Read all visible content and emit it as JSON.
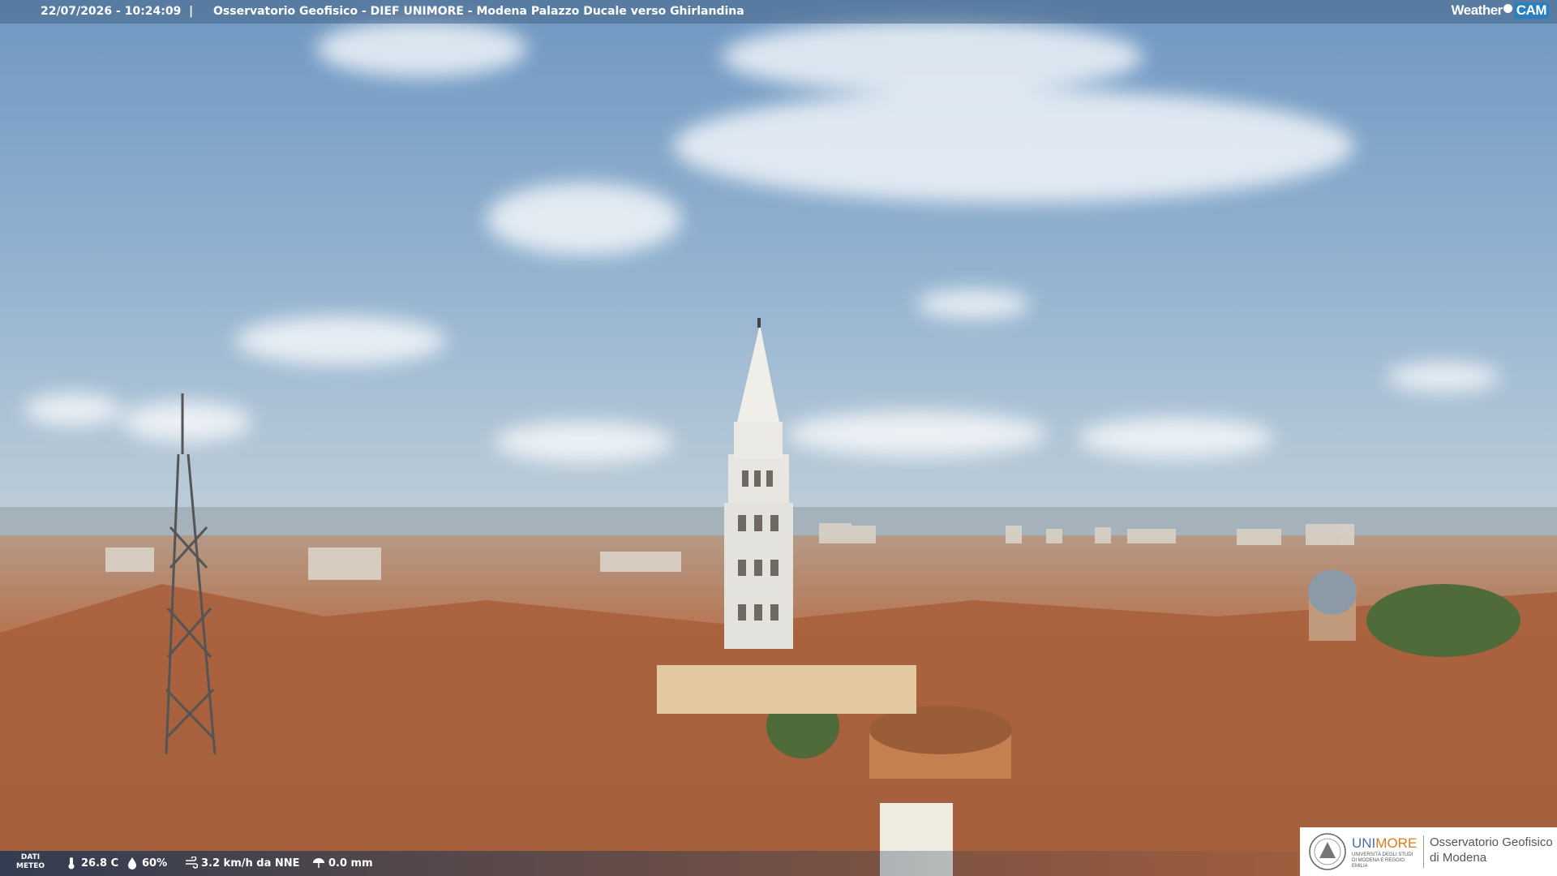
{
  "header": {
    "timestamp": "22/07/2026 - 10:24:09",
    "separator": "|",
    "title": "Osservatorio Geofisico - DIEF UNIMORE - Modena Palazzo Ducale verso Ghirlandina",
    "brand_left": "Weather",
    "brand_right": "CAM"
  },
  "weather": {
    "label_line1": "DATI",
    "label_line2": "METEO",
    "temperature": "26.8 C",
    "humidity": "60%",
    "wind": "3.2 km/h da NNE",
    "rain": "0.0 mm",
    "icons": [
      "thermometer-icon",
      "humidity-icon",
      "wind-icon",
      "rain-icon"
    ]
  },
  "footer_logo": {
    "brand_prefix": "UNI",
    "brand_suffix": "MORE",
    "brand_sub": "UNIVERSITÀ DEGLI STUDI DI MODENA E REGGIO EMILIA",
    "observatory_line1": "Osservatorio Geofisico",
    "observatory_line2": "di Modena"
  },
  "colors": {
    "sky_top": "#6f97c2",
    "sky_horizon": "#b9cbd8",
    "roof": "#b7734f",
    "tower": "#e4e2dc",
    "accent": "#2a7fbf"
  }
}
